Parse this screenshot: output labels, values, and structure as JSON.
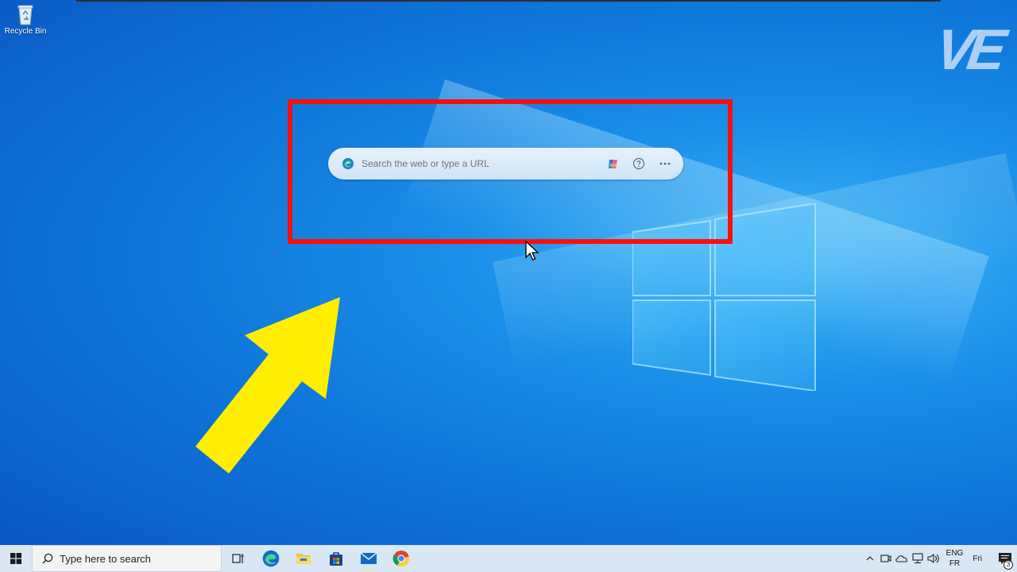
{
  "desktop": {
    "recycle_bin_label": "Recycle Bin",
    "watermark": "VE"
  },
  "edge_search_bar": {
    "placeholder": "Search the web or type a URL",
    "icons": [
      "edge-icon",
      "copilot-icon",
      "help-icon",
      "more-options-icon"
    ]
  },
  "annotations": {
    "highlight_color": "#ff0d0d",
    "arrow_color": "#ffee00"
  },
  "taskbar": {
    "search_placeholder": "Type here to search",
    "pinned": [
      "task-view-icon",
      "edge-icon",
      "file-explorer-icon",
      "store-icon",
      "mail-icon",
      "chrome-icon"
    ],
    "tray": {
      "lang_top": "ENG",
      "lang_bottom": "FR",
      "clock": "Fri",
      "notification_count": "3"
    }
  },
  "colors": {
    "taskbar_bg": "#d9e7f4",
    "desktop_accent": "#0d74d8"
  }
}
